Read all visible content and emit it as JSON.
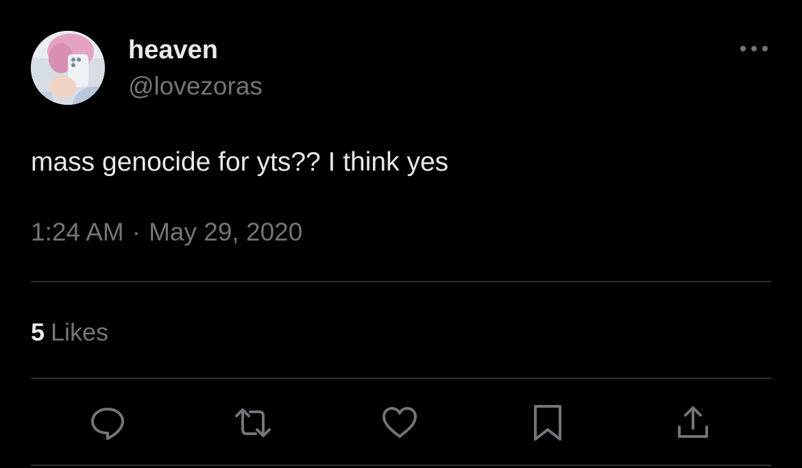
{
  "tweet": {
    "author": {
      "display_name": "heaven",
      "handle": "@lovezoras",
      "avatar_icon": "profile-photo"
    },
    "text": "mass genocide for yts?? I think yes",
    "time": "1:24 AM",
    "separator": "·",
    "date": "May 29, 2020",
    "likes": {
      "count": "5",
      "label": "Likes"
    },
    "actions": [
      {
        "name": "reply",
        "icon": "speech-bubble-icon"
      },
      {
        "name": "retweet",
        "icon": "retweet-arrows-icon"
      },
      {
        "name": "like",
        "icon": "heart-icon"
      },
      {
        "name": "bookmark",
        "icon": "bookmark-icon"
      },
      {
        "name": "share",
        "icon": "share-upload-icon"
      }
    ],
    "more_icon": "more-dots-icon"
  },
  "colors": {
    "background": "#000000",
    "primary_text": "#e7e9ea",
    "secondary_text": "#71767b",
    "divider": "#2f3336"
  }
}
